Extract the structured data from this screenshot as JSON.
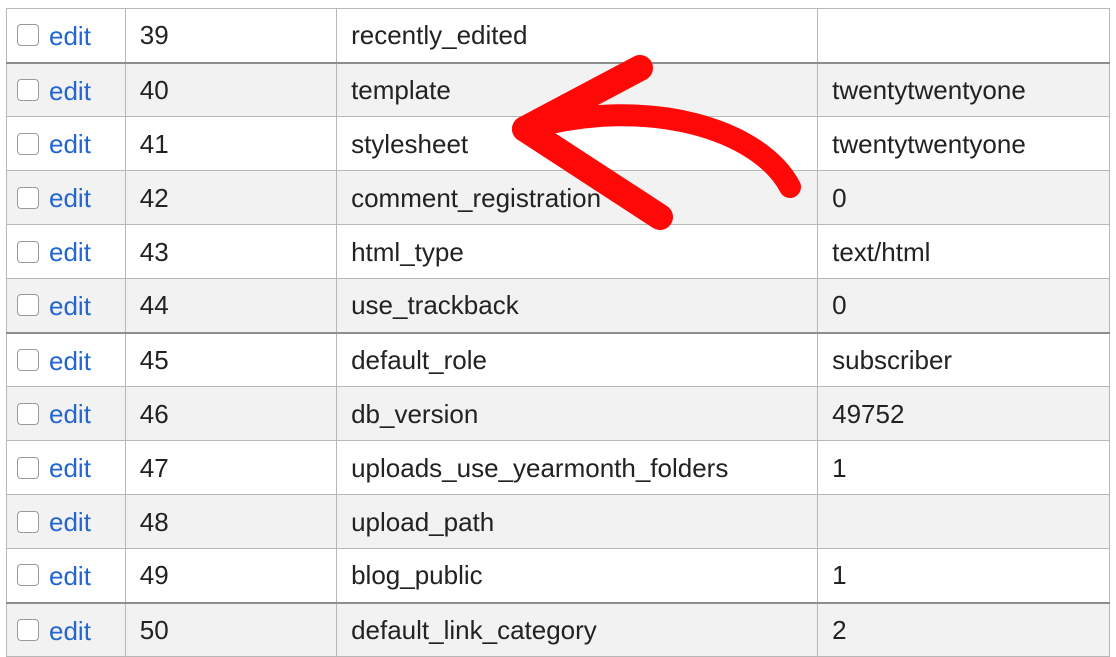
{
  "action_label": "edit",
  "rows": [
    {
      "id": "39",
      "name": "recently_edited",
      "value": "",
      "alt": false,
      "heavy_top": false,
      "heavy_bottom": true
    },
    {
      "id": "40",
      "name": "template",
      "value": "twentytwentyone",
      "alt": true,
      "heavy_top": false,
      "heavy_bottom": false
    },
    {
      "id": "41",
      "name": "stylesheet",
      "value": "twentytwentyone",
      "alt": false,
      "heavy_top": false,
      "heavy_bottom": false
    },
    {
      "id": "42",
      "name": "comment_registration",
      "value": "0",
      "alt": true,
      "heavy_top": false,
      "heavy_bottom": false
    },
    {
      "id": "43",
      "name": "html_type",
      "value": "text/html",
      "alt": false,
      "heavy_top": false,
      "heavy_bottom": false
    },
    {
      "id": "44",
      "name": "use_trackback",
      "value": "0",
      "alt": true,
      "heavy_top": false,
      "heavy_bottom": true
    },
    {
      "id": "45",
      "name": "default_role",
      "value": "subscriber",
      "alt": false,
      "heavy_top": false,
      "heavy_bottom": false
    },
    {
      "id": "46",
      "name": "db_version",
      "value": "49752",
      "alt": true,
      "heavy_top": false,
      "heavy_bottom": false
    },
    {
      "id": "47",
      "name": "uploads_use_yearmonth_folders",
      "value": "1",
      "alt": false,
      "heavy_top": false,
      "heavy_bottom": false
    },
    {
      "id": "48",
      "name": "upload_path",
      "value": "",
      "alt": true,
      "heavy_top": false,
      "heavy_bottom": false
    },
    {
      "id": "49",
      "name": "blog_public",
      "value": "1",
      "alt": false,
      "heavy_top": false,
      "heavy_bottom": true
    },
    {
      "id": "50",
      "name": "default_link_category",
      "value": "2",
      "alt": true,
      "heavy_top": false,
      "heavy_bottom": false
    }
  ],
  "annotation": {
    "kind": "arrow",
    "color": "#ff0000"
  }
}
